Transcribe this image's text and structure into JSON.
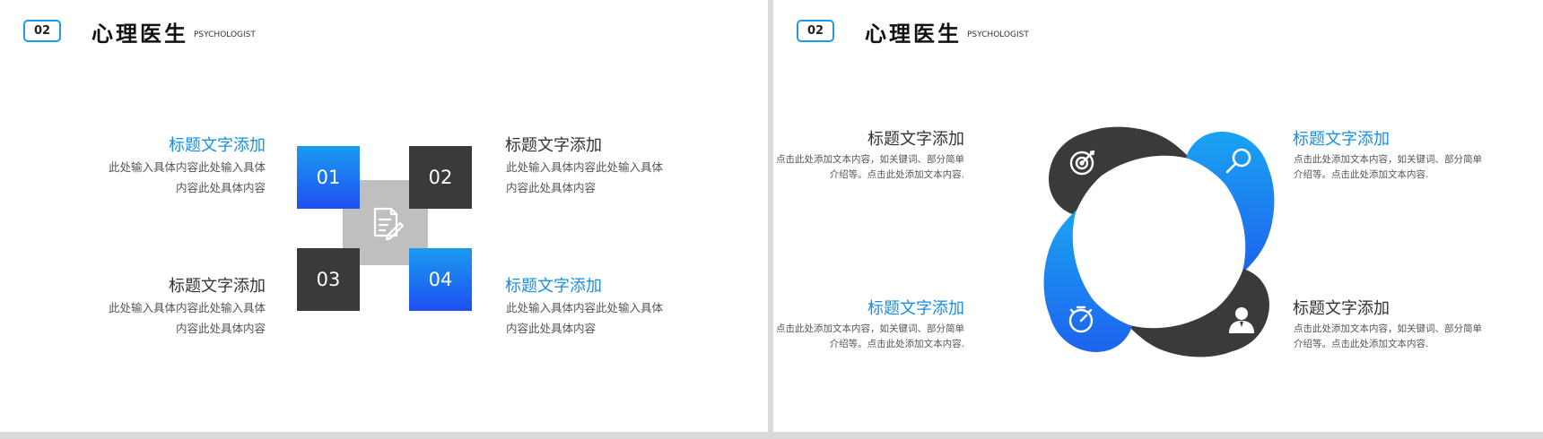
{
  "colors": {
    "accent_blue": "#1a8ee0",
    "dark": "#3a3a3a",
    "grey": "#bfbfbf"
  },
  "slide1": {
    "badge": "02",
    "heading": "心理医生",
    "subheading": "PSYCHOLOGIST",
    "items": [
      {
        "number": "01",
        "title": "标题文字添加",
        "desc_line1": "此处输入具体内容此处输入具体",
        "desc_line2": "内容此处具体内容"
      },
      {
        "number": "02",
        "title": "标题文字添加",
        "desc_line1": "此处输入具体内容此处输入具体",
        "desc_line2": "内容此处具体内容"
      },
      {
        "number": "03",
        "title": "标题文字添加",
        "desc_line1": "此处输入具体内容此处输入具体",
        "desc_line2": "内容此处具体内容"
      },
      {
        "number": "04",
        "title": "标题文字添加",
        "desc_line1": "此处输入具体内容此处输入具体",
        "desc_line2": "内容此处具体内容"
      }
    ],
    "center_icon": "document-edit-icon"
  },
  "slide2": {
    "badge": "02",
    "heading": "心理医生",
    "subheading": "PSYCHOLOGIST",
    "items": [
      {
        "title": "标题文字添加",
        "desc_line1": "点击此处添加文本内容，如关键词、部分简单",
        "desc_line2": "介绍等。点击此处添加文本内容.",
        "icon": "target-icon"
      },
      {
        "title": "标题文字添加",
        "desc_line1": "点击此处添加文本内容，如关键词、部分简单",
        "desc_line2": "介绍等。点击此处添加文本内容.",
        "icon": "magnifier-icon"
      },
      {
        "title": "标题文字添加",
        "desc_line1": "点击此处添加文本内容，如关键词、部分简单",
        "desc_line2": "介绍等。点击此处添加文本内容.",
        "icon": "stopwatch-icon"
      },
      {
        "title": "标题文字添加",
        "desc_line1": "点击此处添加文本内容，如关键词、部分简单",
        "desc_line2": "介绍等。点击此处添加文本内容.",
        "icon": "businessman-icon"
      }
    ]
  }
}
